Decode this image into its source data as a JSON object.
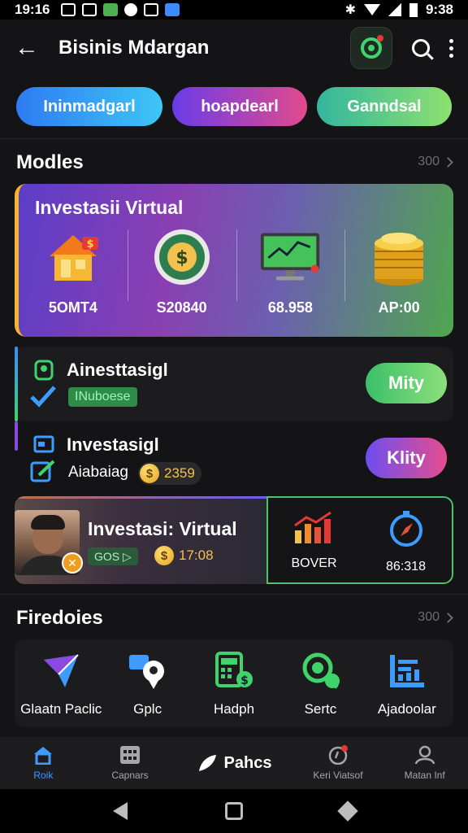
{
  "status_bar": {
    "time_left": "19:16",
    "time_right": "9:38"
  },
  "header": {
    "title": "Bisinis Mdargan"
  },
  "pills": [
    "Ininmadgarl",
    "hoapdearl",
    "Ganndsal"
  ],
  "sections": {
    "modules": {
      "title": "Modles",
      "more": "300"
    },
    "features": {
      "title": "Firedoies",
      "more": "300"
    }
  },
  "invest_card": {
    "title": "Investasii Virtual",
    "stats": [
      {
        "icon": "house-icon",
        "value": "5OMT4"
      },
      {
        "icon": "dollar-seal-icon",
        "value": "S20840"
      },
      {
        "icon": "monitor-chart-icon",
        "value": "68.958"
      },
      {
        "icon": "coin-stack-icon",
        "value": "AP:00"
      }
    ]
  },
  "tasks": [
    {
      "title": "Ainesttasigl",
      "badge": "INuboese",
      "button": "Mity"
    },
    {
      "title": "Investasigl",
      "subtitle": "Aiabaiag",
      "coins": "2359",
      "button": "Klity"
    }
  ],
  "profile_card": {
    "title": "Investasi: Virtual",
    "chip": "GOS",
    "coins": "17:08",
    "stats": [
      {
        "icon": "bar-chart-icon",
        "label": "BOVER"
      },
      {
        "icon": "compass-icon",
        "label": "86:318"
      }
    ]
  },
  "features": [
    {
      "icon": "paper-plane-icon",
      "label": "Glaatn Paclic"
    },
    {
      "icon": "chat-pin-icon",
      "label": "Gplc"
    },
    {
      "icon": "calculator-icon",
      "label": "Hadph"
    },
    {
      "icon": "search-globe-icon",
      "label": "Sertc"
    },
    {
      "icon": "analytics-icon",
      "label": "Ajadoolar"
    }
  ],
  "bottom_nav": [
    {
      "icon": "home-icon",
      "label": "Roik"
    },
    {
      "icon": "grid-icon",
      "label": "Capnars"
    },
    {
      "icon": "leaf-icon",
      "label": "Pahcs"
    },
    {
      "icon": "alert-icon",
      "label": "Keri Viatsof"
    },
    {
      "icon": "user-icon",
      "label": "Matan Inf"
    }
  ],
  "colors": {
    "accent_blue": "#3e9bff",
    "accent_green": "#3fd46b",
    "gold": "#f2c14e"
  }
}
